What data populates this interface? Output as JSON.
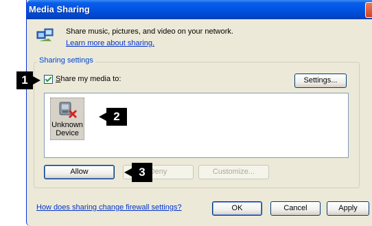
{
  "window": {
    "title": "Media Sharing"
  },
  "header": {
    "description": "Share music, pictures, and video on your network.",
    "learn_more_link": "Learn more about sharing."
  },
  "sharing_settings": {
    "group_label": "Sharing settings",
    "share_checkbox_label": "Share my media to:",
    "share_checked": true,
    "settings_button": "Settings..."
  },
  "devices": [
    {
      "name_line1": "Unknown",
      "name_line2": "Device"
    }
  ],
  "actions": {
    "allow": "Allow",
    "deny": "Deny",
    "customize": "Customize..."
  },
  "footer": {
    "firewall_link": "How does sharing change firewall settings?",
    "ok": "OK",
    "cancel": "Cancel",
    "apply": "Apply"
  },
  "callouts": [
    "1",
    "2",
    "3"
  ],
  "colors": {
    "titlebar": "#0054e3",
    "dialog_bg": "#ece9d8",
    "link": "#0033cc",
    "group_label": "#0046d5",
    "callout_bg": "#000000"
  }
}
